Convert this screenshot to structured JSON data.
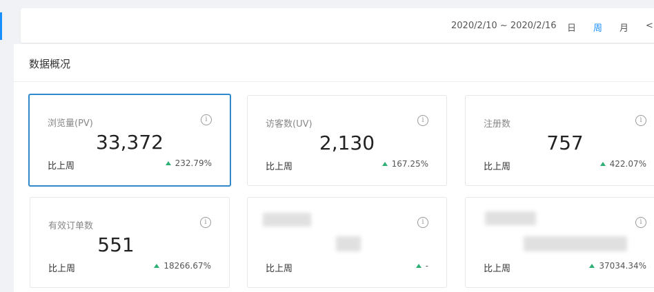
{
  "toolbar": {
    "date_range": "2020/2/10 ~ 2020/2/16",
    "periods": [
      {
        "label": "日",
        "active": false
      },
      {
        "label": "周",
        "active": true
      },
      {
        "label": "月",
        "active": false
      }
    ],
    "prev_label": "<",
    "accent_color": "#1890ff"
  },
  "overview": {
    "title": "数据概况",
    "cards": [
      {
        "label": "浏览量(PV)",
        "value": "33,372",
        "compare_label": "比上周",
        "change": "232.79%",
        "selected": true
      },
      {
        "label": "访客数(UV)",
        "value": "2,130",
        "compare_label": "比上周",
        "change": "167.25%",
        "selected": false
      },
      {
        "label": "注册数",
        "value": "757",
        "compare_label": "比上周",
        "change": "422.07%",
        "selected": false
      },
      {
        "label": "有效订单数",
        "value": "551",
        "compare_label": "比上周",
        "change": "18266.67%",
        "selected": false
      },
      {
        "label": "",
        "value": "",
        "compare_label": "比上周",
        "change": "-",
        "selected": false
      },
      {
        "label": "",
        "value": "",
        "compare_label": "比上周",
        "change": "37034.34%",
        "selected": false
      }
    ],
    "info_icon_glyph": "i",
    "up_color": "#2eaf76"
  }
}
